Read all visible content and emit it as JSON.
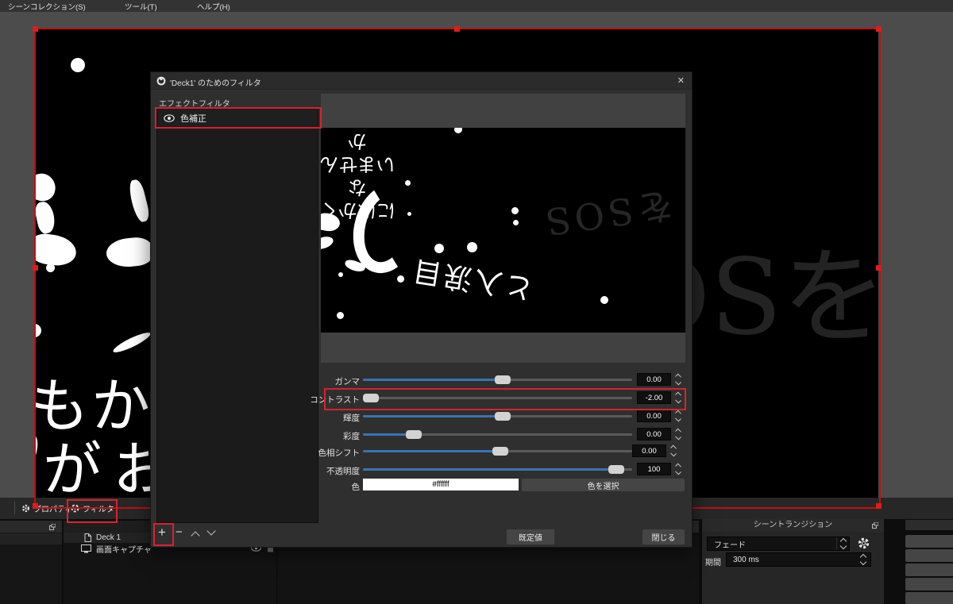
{
  "menu": {
    "items": [
      "シーンコレクション(S)",
      "ツール(T)",
      "ヘルプ(H)"
    ]
  },
  "dialog": {
    "title": "'Deck1' のためのフィルタ",
    "close_icon": "✕",
    "effects_label": "エフェクトフィルタ",
    "filter_item": {
      "name": "色補正"
    },
    "sliders": [
      {
        "label": "ガンマ",
        "value": "0.00",
        "fraction": 0.52
      },
      {
        "label": "コントラスト",
        "value": "-2.00",
        "fraction": 0.0
      },
      {
        "label": "輝度",
        "value": "0.00",
        "fraction": 0.52
      },
      {
        "label": "彩度",
        "value": "0.00",
        "fraction": 0.17
      },
      {
        "label": "色相シフト",
        "value": "0.00",
        "fraction": 0.51
      },
      {
        "label": "不透明度",
        "value": "100",
        "fraction": 0.97
      }
    ],
    "color_row": {
      "label": "色",
      "value": "#ffffff",
      "button": "色を選択"
    },
    "footer": {
      "add": "+",
      "remove": "−",
      "defaults": "既定値",
      "close": "閉じる"
    }
  },
  "preview": {
    "text_top_line1": "いませんか",
    "text_top_line2": "にほかくな",
    "text_sos": "をSOS",
    "text_bottom": "と入涙目"
  },
  "canvas": {
    "text_line1": "もかも",
    "text_line2": "がお",
    "text_right": "OSを"
  },
  "source_toolbar": {
    "properties": "プロパティ",
    "filters": "フィルタ"
  },
  "docks": {
    "sources": {
      "rows": [
        {
          "name": "Deck 1"
        },
        {
          "name": "画面キャプチャ"
        }
      ]
    },
    "transitions": {
      "title": "シーントランジション",
      "selected": "フェード",
      "duration_label": "期間",
      "duration_value": "300 ms"
    }
  },
  "colors": {
    "annotation_red": "#d8222e",
    "selection_red": "#c01010",
    "slider_blue": "#3874b4"
  }
}
